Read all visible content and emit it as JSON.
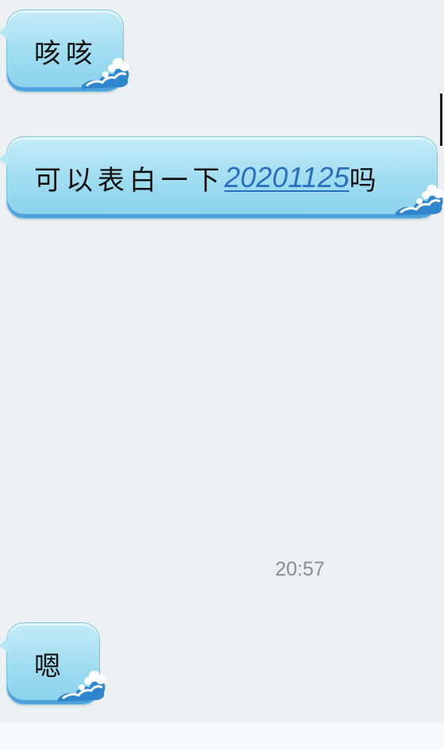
{
  "messages": [
    {
      "id": "m1",
      "text": "咳咳"
    },
    {
      "id": "m2",
      "text_before": "可以表白一下",
      "link_text": "20201125",
      "text_after": "吗"
    },
    {
      "id": "m3",
      "text": "嗯"
    }
  ],
  "timestamp": "20:57",
  "colors": {
    "background": "#edf0f2",
    "bubble": "#9fdcf0",
    "bubble_edge": "#4fa2dc",
    "link": "#2b6fc2",
    "timestamp": "#8a8d90"
  },
  "icons": [
    "wave-decoration-icon"
  ]
}
